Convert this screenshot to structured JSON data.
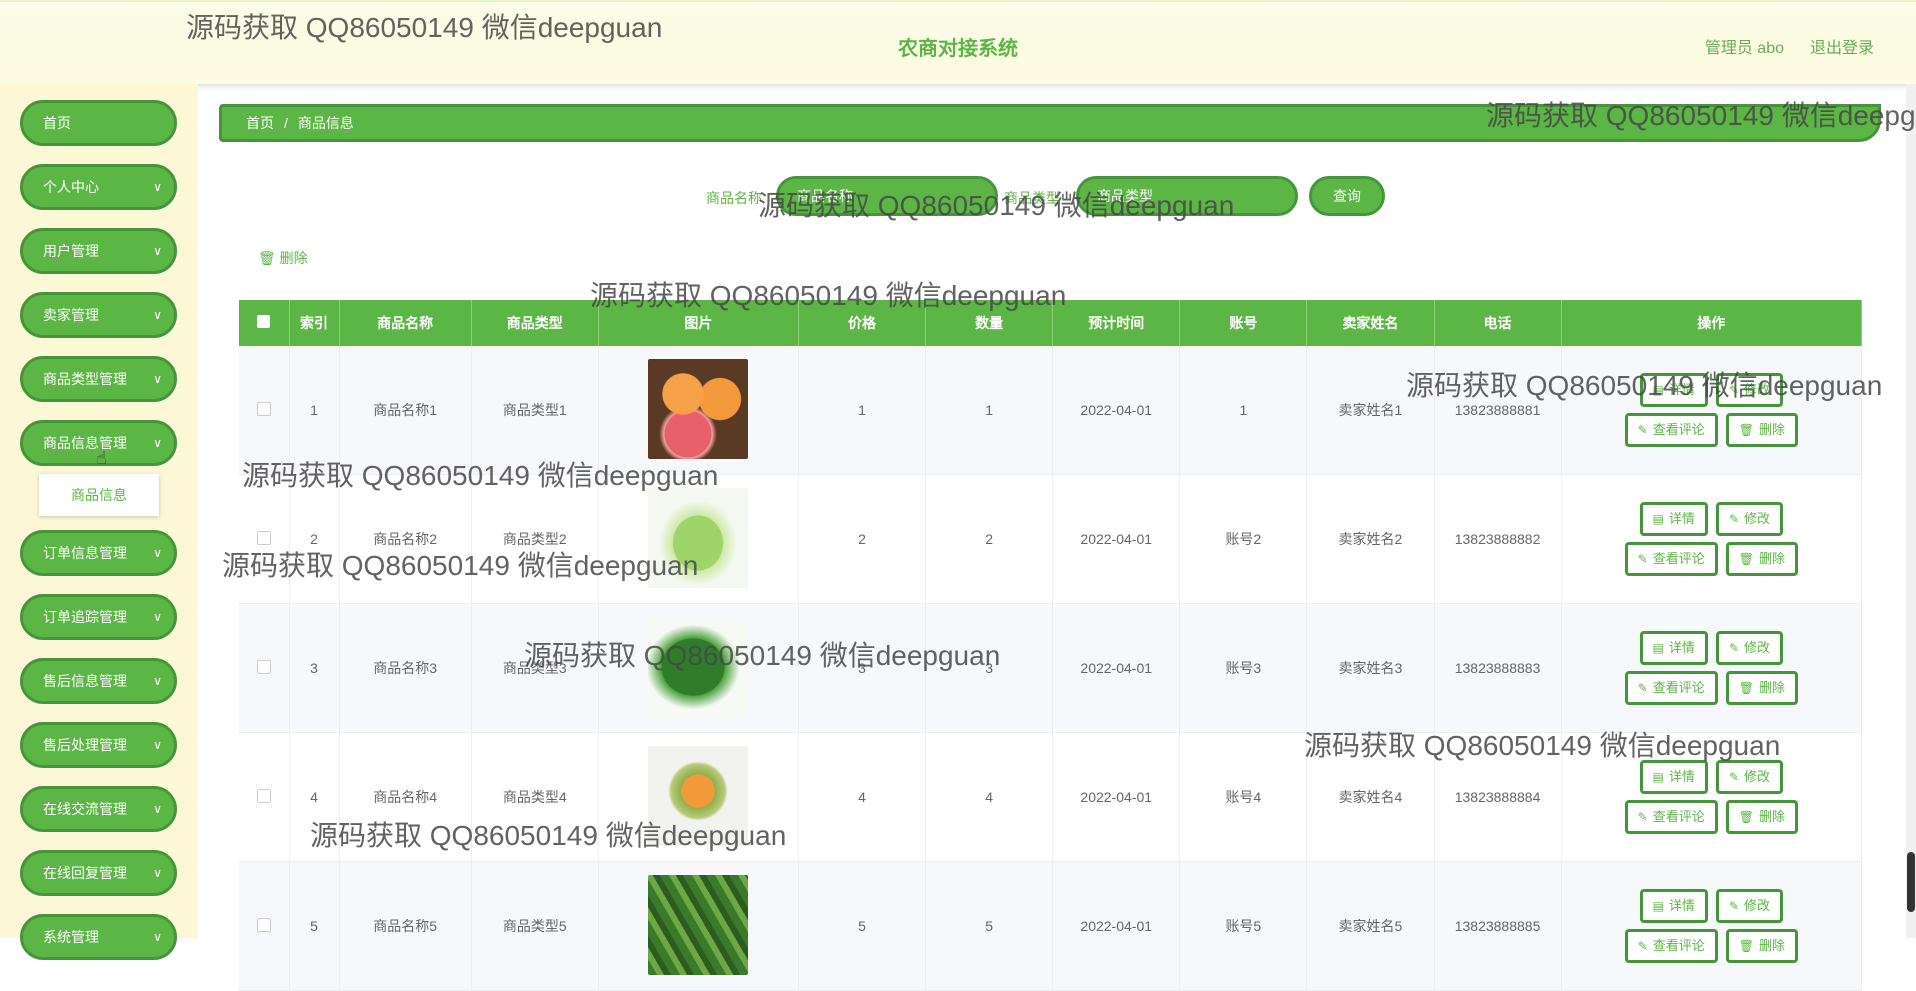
{
  "header": {
    "title": "农商对接系统",
    "admin": "管理员 abo",
    "logout": "退出登录"
  },
  "sidebar": {
    "items": [
      {
        "label": "首页",
        "chevron": false
      },
      {
        "label": "个人中心",
        "chevron": true
      },
      {
        "label": "用户管理",
        "chevron": true
      },
      {
        "label": "卖家管理",
        "chevron": true
      },
      {
        "label": "商品类型管理",
        "chevron": true
      },
      {
        "label": "商品信息管理",
        "chevron": true
      },
      {
        "label": "订单信息管理",
        "chevron": true
      },
      {
        "label": "订单追踪管理",
        "chevron": true
      },
      {
        "label": "售后信息管理",
        "chevron": true
      },
      {
        "label": "售后处理管理",
        "chevron": true
      },
      {
        "label": "在线交流管理",
        "chevron": true
      },
      {
        "label": "在线回复管理",
        "chevron": true
      },
      {
        "label": "系统管理",
        "chevron": true
      }
    ],
    "submenu": "商品信息"
  },
  "breadcrumb": {
    "home": "首页",
    "sep": "/",
    "current": "商品信息"
  },
  "search": {
    "name_label": "商品名称",
    "name_value": "商品名称",
    "type_label": "商品类型",
    "type_value": "商品类型",
    "query_btn": "查询"
  },
  "toolbar": {
    "delete": "删除"
  },
  "table": {
    "headers": [
      "索引",
      "商品名称",
      "商品类型",
      "图片",
      "价格",
      "数量",
      "预计时间",
      "账号",
      "卖家姓名",
      "电话",
      "操作"
    ],
    "rows": [
      {
        "idx": "1",
        "name": "商品名称1",
        "type": "商品类型1",
        "price": "1",
        "qty": "1",
        "date": "2022-04-01",
        "account": "1",
        "seller": "卖家姓名1",
        "phone": "13823888881"
      },
      {
        "idx": "2",
        "name": "商品名称2",
        "type": "商品类型2",
        "price": "2",
        "qty": "2",
        "date": "2022-04-01",
        "account": "账号2",
        "seller": "卖家姓名2",
        "phone": "13823888882"
      },
      {
        "idx": "3",
        "name": "商品名称3",
        "type": "商品类型3",
        "price": "3",
        "qty": "3",
        "date": "2022-04-01",
        "account": "账号3",
        "seller": "卖家姓名3",
        "phone": "13823888883"
      },
      {
        "idx": "4",
        "name": "商品名称4",
        "type": "商品类型4",
        "price": "4",
        "qty": "4",
        "date": "2022-04-01",
        "account": "账号4",
        "seller": "卖家姓名4",
        "phone": "13823888884"
      },
      {
        "idx": "5",
        "name": "商品名称5",
        "type": "商品类型5",
        "price": "5",
        "qty": "5",
        "date": "2022-04-01",
        "account": "账号5",
        "seller": "卖家姓名5",
        "phone": "13823888885"
      }
    ],
    "ops": {
      "detail": "详情",
      "edit": "修改",
      "review": "查看评论",
      "delete": "删除"
    }
  },
  "watermark": "源码获取 QQ86050149 微信deepguan",
  "colors": {
    "primary": "#5cb646",
    "border": "#45963a",
    "sidebar_bg": "#fdf7d6",
    "header_bg": "#fdfbe0"
  }
}
